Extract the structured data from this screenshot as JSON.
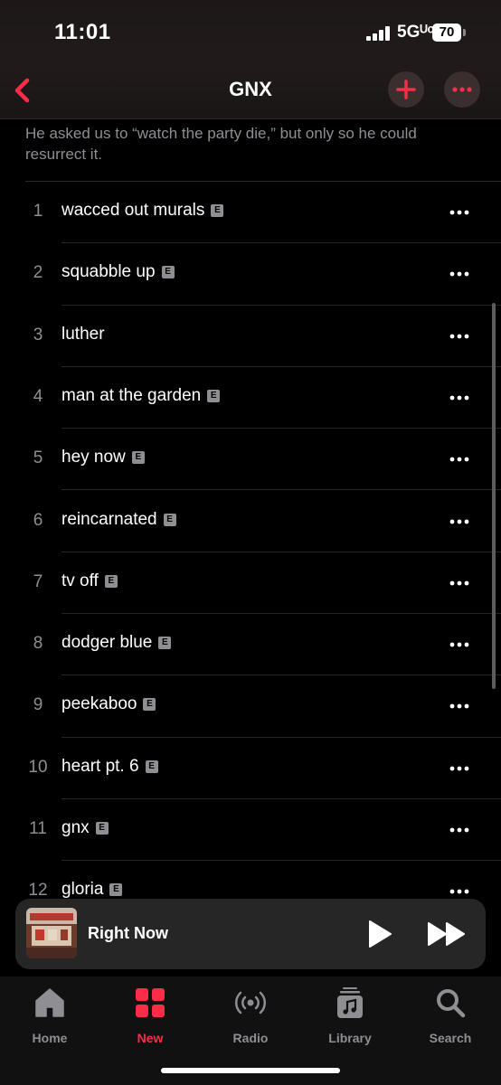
{
  "status_bar": {
    "time": "11:01",
    "network": "5Gᵁᶜ",
    "battery": "70"
  },
  "nav": {
    "title": "GNX"
  },
  "album": {
    "description": "He asked us to “watch the party die,” but only so he could resurrect it."
  },
  "tracks": [
    {
      "number": "1",
      "title": "wacced out murals",
      "explicit": "E"
    },
    {
      "number": "2",
      "title": "squabble up",
      "explicit": "E"
    },
    {
      "number": "3",
      "title": "luther",
      "explicit": ""
    },
    {
      "number": "4",
      "title": "man at the garden",
      "explicit": "E"
    },
    {
      "number": "5",
      "title": "hey now",
      "explicit": "E"
    },
    {
      "number": "6",
      "title": "reincarnated",
      "explicit": "E"
    },
    {
      "number": "7",
      "title": "tv off",
      "explicit": "E"
    },
    {
      "number": "8",
      "title": "dodger blue",
      "explicit": "E"
    },
    {
      "number": "9",
      "title": "peekaboo",
      "explicit": "E"
    },
    {
      "number": "10",
      "title": "heart pt. 6",
      "explicit": "E"
    },
    {
      "number": "11",
      "title": "gnx",
      "explicit": "E"
    },
    {
      "number": "12",
      "title": "gloria",
      "explicit": "E"
    }
  ],
  "mini_player": {
    "title": "Right Now"
  },
  "tabs": [
    {
      "label": "Home",
      "icon": "home-icon",
      "active": false
    },
    {
      "label": "New",
      "icon": "new-grid-icon",
      "active": true
    },
    {
      "label": "Radio",
      "icon": "radio-icon",
      "active": false
    },
    {
      "label": "Library",
      "icon": "library-icon",
      "active": false
    },
    {
      "label": "Search",
      "icon": "search-icon",
      "active": false
    }
  ],
  "colors": {
    "accent": "#fa2d48",
    "background": "#000000",
    "secondary_text": "#8e8e93"
  }
}
